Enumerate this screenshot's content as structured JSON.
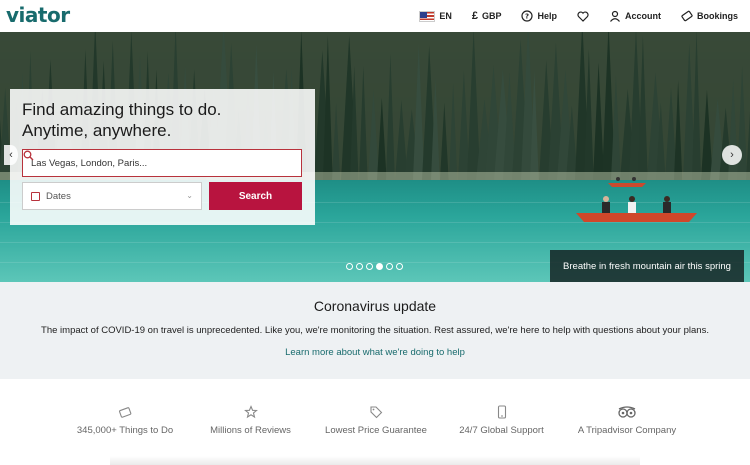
{
  "header": {
    "logo": "viator",
    "nav": {
      "language": "EN",
      "currency_symbol": "£",
      "currency": "GBP",
      "help": "Help",
      "account": "Account",
      "bookings": "Bookings"
    }
  },
  "hero": {
    "title_line1": "Find amazing things to do.",
    "title_line2": "Anytime, anywhere.",
    "search_placeholder": "Las Vegas, London, Paris...",
    "dates_label": "Dates",
    "search_button": "Search",
    "caption": "Breathe in fresh mountain air this spring",
    "slides": 6,
    "active_slide": 4
  },
  "covid": {
    "title": "Coronavirus update",
    "body": "The impact of COVID-19 on travel is unprecedented. Like you, we're monitoring the situation. Rest assured, we're here to help with questions about your plans.",
    "link": "Learn more about what we're doing to help"
  },
  "features": [
    {
      "label": "345,000+ Things to Do",
      "icon": "ticket-icon"
    },
    {
      "label": "Millions of Reviews",
      "icon": "star-icon"
    },
    {
      "label": "Lowest Price Guarantee",
      "icon": "price-tag-icon"
    },
    {
      "label": "24/7 Global Support",
      "icon": "phone-icon"
    },
    {
      "label": "A Tripadvisor Company",
      "icon": "owl-icon"
    }
  ],
  "colors": {
    "brand": "#186b6d",
    "accent": "#b8143f",
    "lake": "#2aa59a",
    "forest": "#2b3d2a"
  }
}
